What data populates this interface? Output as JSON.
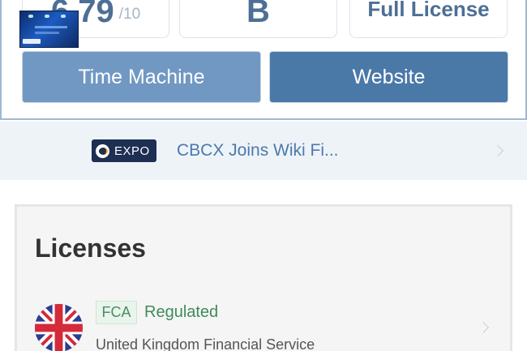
{
  "summary": {
    "score": "6.79",
    "score_suffix": "/10",
    "grade": "B",
    "license_type": "Full License"
  },
  "actions": {
    "time_machine": "Time Machine",
    "website": "Website"
  },
  "news": {
    "badge": "EXPO",
    "title": "CBCX Joins Wiki Fi..."
  },
  "licenses": {
    "heading": "Licenses",
    "items": [
      {
        "regulator": "FCA",
        "status": "Regulated",
        "authority": "United Kingdom Financial Service",
        "status_color": "#3f8b5a"
      }
    ]
  },
  "colors": {
    "accent": "#4a79a8",
    "accent_light": "#7198c2",
    "news_link": "#4c79ab",
    "expo_badge_bg": "#1d2f52"
  },
  "icons": {
    "news_chevron": "chevron-right-icon",
    "license_chevron": "chevron-right-icon",
    "flag": "uk-flag-icon",
    "expo": "expo-logo-icon"
  }
}
